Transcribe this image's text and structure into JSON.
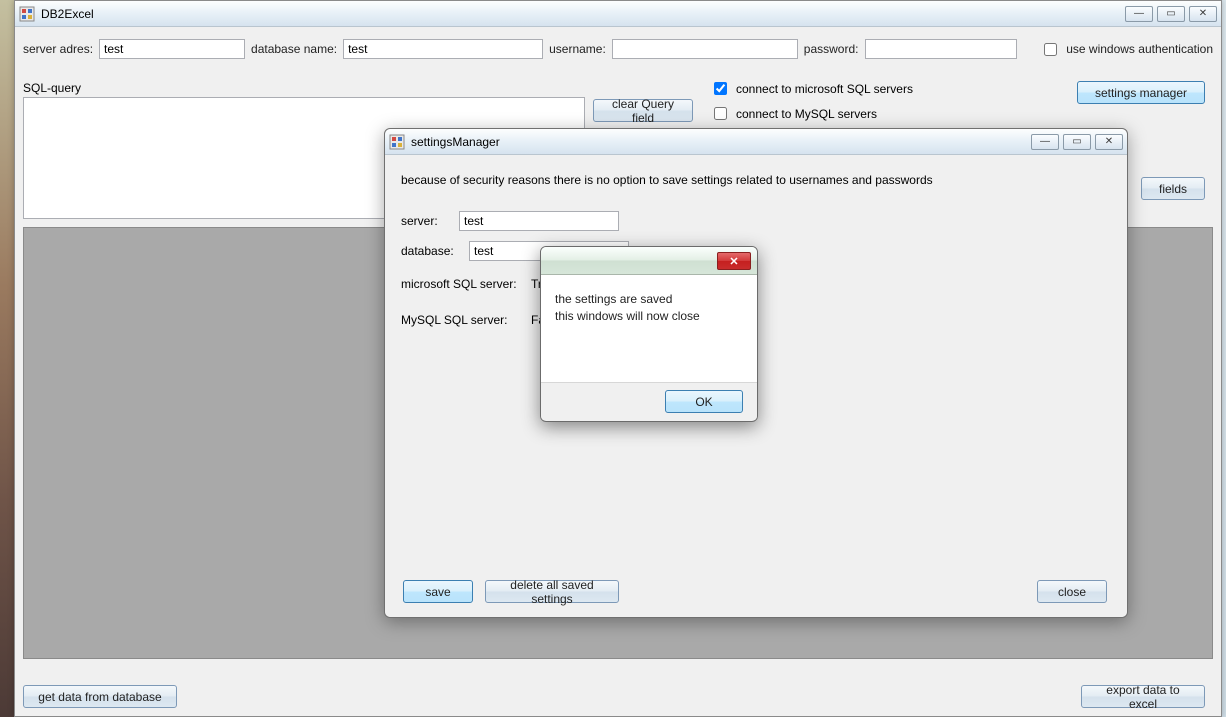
{
  "app": {
    "title": "DB2Excel"
  },
  "main": {
    "server_label": "server adres:",
    "server_value": "test",
    "database_label": "database name:",
    "database_value": "test",
    "username_label": "username:",
    "username_value": "",
    "password_label": "password:",
    "password_value": "",
    "use_win_auth_label": "use windows authentication",
    "use_win_auth_checked": false,
    "sql_query_label": "SQL-query",
    "sql_query_value": "",
    "clear_query_button": "clear Query field",
    "connect_mssql_label": "connect to microsoft SQL  servers",
    "connect_mssql_checked": true,
    "connect_mysql_label": "connect to MySQL servers",
    "connect_mysql_checked": false,
    "settings_manager_button": "settings manager",
    "fields_button": "fields",
    "get_data_button": "get data from database",
    "export_excel_button": "export data to excel"
  },
  "settings_manager": {
    "title": "settingsManager",
    "security_note": "because of security reasons there is no option to save settings related to usernames and passwords",
    "server_label": "server:",
    "server_value": "test",
    "database_label": "database:",
    "database_value": "test",
    "mssql_label": "microsoft SQL server:",
    "mssql_value": "True",
    "mysql_label": "MySQL SQL server:",
    "mysql_value": "False",
    "save_button": "save",
    "delete_button": "delete all saved settings",
    "close_button": "close"
  },
  "messagebox": {
    "line1": "the settings are saved",
    "line2": " this windows will now close",
    "ok_button": "OK"
  },
  "window_controls": {
    "minimize": "—",
    "maximize": "▭",
    "close": "✕"
  }
}
